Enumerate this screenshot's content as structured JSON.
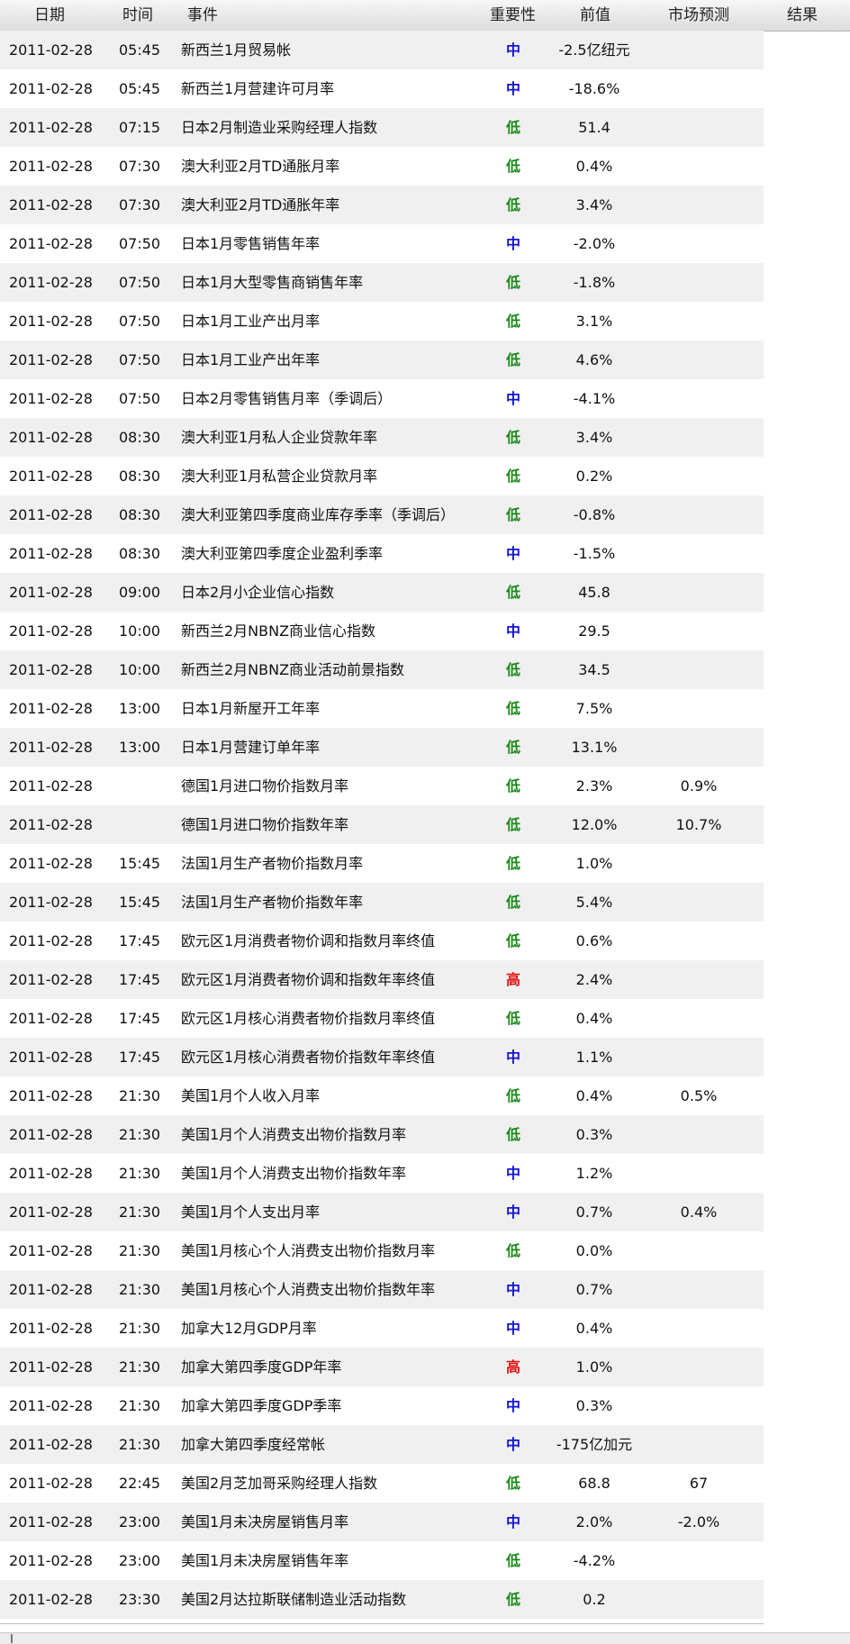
{
  "header": {
    "date": "日期",
    "time": "时间",
    "event": "事件",
    "importance": "重要性",
    "previous": "前值",
    "forecast": "市场预测",
    "result": "结果"
  },
  "colors": {
    "中": "#1414d2",
    "低": "#1a8a1a",
    "高": "#e01010"
  },
  "rows": [
    {
      "date": "2011-02-28",
      "time": "05:45",
      "event": "新西兰1月贸易帐",
      "importance": "中",
      "previous": "-2.5亿纽元",
      "forecast": "",
      "result": ""
    },
    {
      "date": "2011-02-28",
      "time": "05:45",
      "event": "新西兰1月营建许可月率",
      "importance": "中",
      "previous": "-18.6%",
      "forecast": "",
      "result": ""
    },
    {
      "date": "2011-02-28",
      "time": "07:15",
      "event": "日本2月制造业采购经理人指数",
      "importance": "低",
      "previous": "51.4",
      "forecast": "",
      "result": ""
    },
    {
      "date": "2011-02-28",
      "time": "07:30",
      "event": "澳大利亚2月TD通胀月率",
      "importance": "低",
      "previous": "0.4%",
      "forecast": "",
      "result": ""
    },
    {
      "date": "2011-02-28",
      "time": "07:30",
      "event": "澳大利亚2月TD通胀年率",
      "importance": "低",
      "previous": "3.4%",
      "forecast": "",
      "result": ""
    },
    {
      "date": "2011-02-28",
      "time": "07:50",
      "event": "日本1月零售销售年率",
      "importance": "中",
      "previous": "-2.0%",
      "forecast": "",
      "result": ""
    },
    {
      "date": "2011-02-28",
      "time": "07:50",
      "event": "日本1月大型零售商销售年率",
      "importance": "低",
      "previous": "-1.8%",
      "forecast": "",
      "result": ""
    },
    {
      "date": "2011-02-28",
      "time": "07:50",
      "event": "日本1月工业产出月率",
      "importance": "低",
      "previous": "3.1%",
      "forecast": "",
      "result": ""
    },
    {
      "date": "2011-02-28",
      "time": "07:50",
      "event": "日本1月工业产出年率",
      "importance": "低",
      "previous": "4.6%",
      "forecast": "",
      "result": ""
    },
    {
      "date": "2011-02-28",
      "time": "07:50",
      "event": "日本2月零售销售月率（季调后）",
      "importance": "中",
      "previous": "-4.1%",
      "forecast": "",
      "result": ""
    },
    {
      "date": "2011-02-28",
      "time": "08:30",
      "event": "澳大利亚1月私人企业贷款年率",
      "importance": "低",
      "previous": "3.4%",
      "forecast": "",
      "result": ""
    },
    {
      "date": "2011-02-28",
      "time": "08:30",
      "event": "澳大利亚1月私营企业贷款月率",
      "importance": "低",
      "previous": "0.2%",
      "forecast": "",
      "result": ""
    },
    {
      "date": "2011-02-28",
      "time": "08:30",
      "event": "澳大利亚第四季度商业库存季率（季调后）",
      "importance": "低",
      "previous": "-0.8%",
      "forecast": "",
      "result": ""
    },
    {
      "date": "2011-02-28",
      "time": "08:30",
      "event": "澳大利亚第四季度企业盈利季率",
      "importance": "中",
      "previous": "-1.5%",
      "forecast": "",
      "result": ""
    },
    {
      "date": "2011-02-28",
      "time": "09:00",
      "event": "日本2月小企业信心指数",
      "importance": "低",
      "previous": "45.8",
      "forecast": "",
      "result": ""
    },
    {
      "date": "2011-02-28",
      "time": "10:00",
      "event": "新西兰2月NBNZ商业信心指数",
      "importance": "中",
      "previous": "29.5",
      "forecast": "",
      "result": ""
    },
    {
      "date": "2011-02-28",
      "time": "10:00",
      "event": "新西兰2月NBNZ商业活动前景指数",
      "importance": "低",
      "previous": "34.5",
      "forecast": "",
      "result": ""
    },
    {
      "date": "2011-02-28",
      "time": "13:00",
      "event": "日本1月新屋开工年率",
      "importance": "低",
      "previous": "7.5%",
      "forecast": "",
      "result": ""
    },
    {
      "date": "2011-02-28",
      "time": "13:00",
      "event": "日本1月营建订单年率",
      "importance": "低",
      "previous": "13.1%",
      "forecast": "",
      "result": ""
    },
    {
      "date": "2011-02-28",
      "time": "",
      "event": "德国1月进口物价指数月率",
      "importance": "低",
      "previous": "2.3%",
      "forecast": "0.9%",
      "result": ""
    },
    {
      "date": "2011-02-28",
      "time": "",
      "event": "德国1月进口物价指数年率",
      "importance": "低",
      "previous": "12.0%",
      "forecast": "10.7%",
      "result": ""
    },
    {
      "date": "2011-02-28",
      "time": "15:45",
      "event": "法国1月生产者物价指数月率",
      "importance": "低",
      "previous": "1.0%",
      "forecast": "",
      "result": ""
    },
    {
      "date": "2011-02-28",
      "time": "15:45",
      "event": "法国1月生产者物价指数年率",
      "importance": "低",
      "previous": "5.4%",
      "forecast": "",
      "result": ""
    },
    {
      "date": "2011-02-28",
      "time": "17:45",
      "event": "欧元区1月消费者物价调和指数月率终值",
      "importance": "低",
      "previous": "0.6%",
      "forecast": "",
      "result": ""
    },
    {
      "date": "2011-02-28",
      "time": "17:45",
      "event": "欧元区1月消费者物价调和指数年率终值",
      "importance": "高",
      "previous": "2.4%",
      "forecast": "",
      "result": ""
    },
    {
      "date": "2011-02-28",
      "time": "17:45",
      "event": "欧元区1月核心消费者物价指数月率终值",
      "importance": "低",
      "previous": "0.4%",
      "forecast": "",
      "result": ""
    },
    {
      "date": "2011-02-28",
      "time": "17:45",
      "event": "欧元区1月核心消费者物价指数年率终值",
      "importance": "中",
      "previous": "1.1%",
      "forecast": "",
      "result": ""
    },
    {
      "date": "2011-02-28",
      "time": "21:30",
      "event": "美国1月个人收入月率",
      "importance": "低",
      "previous": "0.4%",
      "forecast": "0.5%",
      "result": ""
    },
    {
      "date": "2011-02-28",
      "time": "21:30",
      "event": "美国1月个人消费支出物价指数月率",
      "importance": "低",
      "previous": "0.3%",
      "forecast": "",
      "result": ""
    },
    {
      "date": "2011-02-28",
      "time": "21:30",
      "event": "美国1月个人消费支出物价指数年率",
      "importance": "中",
      "previous": "1.2%",
      "forecast": "",
      "result": ""
    },
    {
      "date": "2011-02-28",
      "time": "21:30",
      "event": "美国1月个人支出月率",
      "importance": "中",
      "previous": "0.7%",
      "forecast": "0.4%",
      "result": ""
    },
    {
      "date": "2011-02-28",
      "time": "21:30",
      "event": "美国1月核心个人消费支出物价指数月率",
      "importance": "低",
      "previous": "0.0%",
      "forecast": "",
      "result": ""
    },
    {
      "date": "2011-02-28",
      "time": "21:30",
      "event": "美国1月核心个人消费支出物价指数年率",
      "importance": "中",
      "previous": "0.7%",
      "forecast": "",
      "result": ""
    },
    {
      "date": "2011-02-28",
      "time": "21:30",
      "event": "加拿大12月GDP月率",
      "importance": "中",
      "previous": "0.4%",
      "forecast": "",
      "result": ""
    },
    {
      "date": "2011-02-28",
      "time": "21:30",
      "event": "加拿大第四季度GDP年率",
      "importance": "高",
      "previous": "1.0%",
      "forecast": "",
      "result": ""
    },
    {
      "date": "2011-02-28",
      "time": "21:30",
      "event": "加拿大第四季度GDP季率",
      "importance": "中",
      "previous": "0.3%",
      "forecast": "",
      "result": ""
    },
    {
      "date": "2011-02-28",
      "time": "21:30",
      "event": "加拿大第四季度经常帐",
      "importance": "中",
      "previous": "-175亿加元",
      "forecast": "",
      "result": ""
    },
    {
      "date": "2011-02-28",
      "time": "22:45",
      "event": "美国2月芝加哥采购经理人指数",
      "importance": "低",
      "previous": "68.8",
      "forecast": "67",
      "result": ""
    },
    {
      "date": "2011-02-28",
      "time": "23:00",
      "event": "美国1月未决房屋销售月率",
      "importance": "中",
      "previous": "2.0%",
      "forecast": "-2.0%",
      "result": ""
    },
    {
      "date": "2011-02-28",
      "time": "23:00",
      "event": "美国1月未决房屋销售年率",
      "importance": "低",
      "previous": "-4.2%",
      "forecast": "",
      "result": ""
    },
    {
      "date": "2011-02-28",
      "time": "23:30",
      "event": "美国2月达拉斯联储制造业活动指数",
      "importance": "低",
      "previous": "0.2",
      "forecast": "",
      "result": ""
    }
  ]
}
